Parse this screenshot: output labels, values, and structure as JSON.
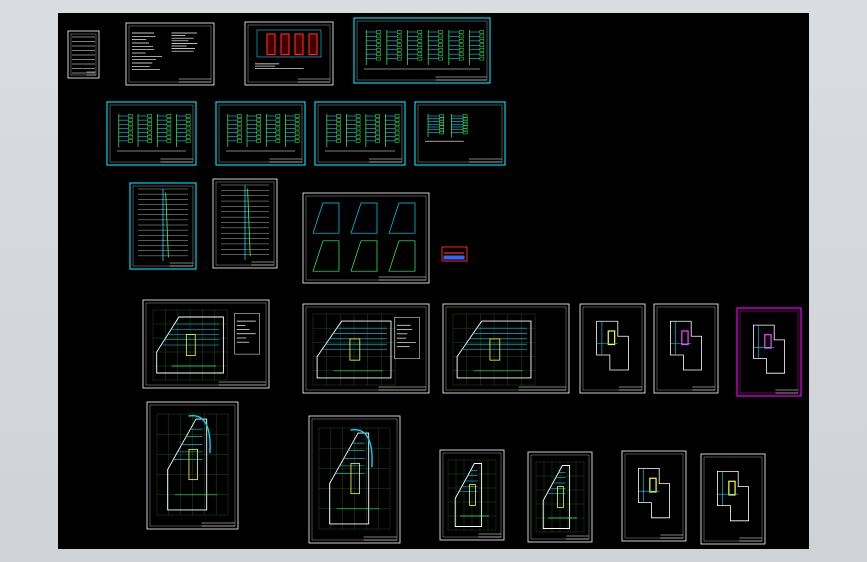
{
  "app": {
    "title": "",
    "viewport_background": "#000000"
  },
  "colors": {
    "frame_white": "#ffffff",
    "frame_cyan": "#00e5ff",
    "frame_magenta": "#ff00ff",
    "line_cyan": "#00d8ff",
    "line_green": "#33ff66",
    "line_yellow": "#ffff33",
    "line_red": "#ff2020",
    "line_blue": "#3366ff",
    "line_magenta": "#ff44ff"
  },
  "sheets": {
    "count": 24,
    "groups": [
      {
        "id": "index-and-notes",
        "count": 4
      },
      {
        "id": "system-diagrams",
        "count": 4
      },
      {
        "id": "riser-and-details",
        "count": 3
      },
      {
        "id": "plans-row-1",
        "count": 6
      },
      {
        "id": "plans-row-2",
        "count": 6
      },
      {
        "id": "legend-block",
        "count": 1
      }
    ]
  }
}
